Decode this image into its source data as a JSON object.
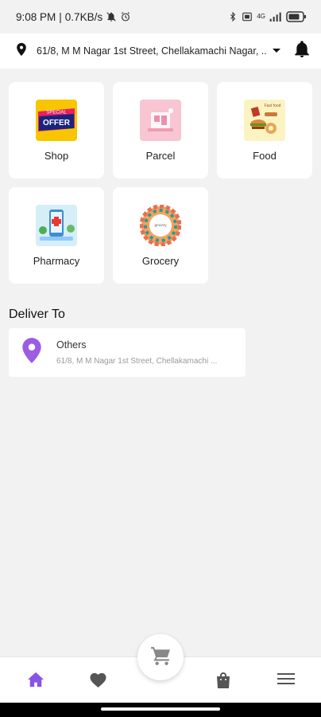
{
  "status_bar": {
    "time": "9:08 PM",
    "speed": "0.7KB/s",
    "network": "4G"
  },
  "header": {
    "location": "61/8, M M Nagar 1st Street, Chellakamachi Nagar, ..."
  },
  "services": [
    {
      "label": "Shop",
      "thumb_text": "SPECIAL OFFER"
    },
    {
      "label": "Parcel"
    },
    {
      "label": "Food",
      "thumb_text": "Fast food"
    },
    {
      "label": "Pharmacy"
    },
    {
      "label": "Grocery"
    }
  ],
  "deliver_to": {
    "title": "Deliver To",
    "address_type": "Others",
    "address": "61/8, M M Nagar 1st Street, Chellakamachi ..."
  },
  "colors": {
    "accent": "#7c4dff",
    "background": "#f2f2f2",
    "card": "#ffffff"
  }
}
